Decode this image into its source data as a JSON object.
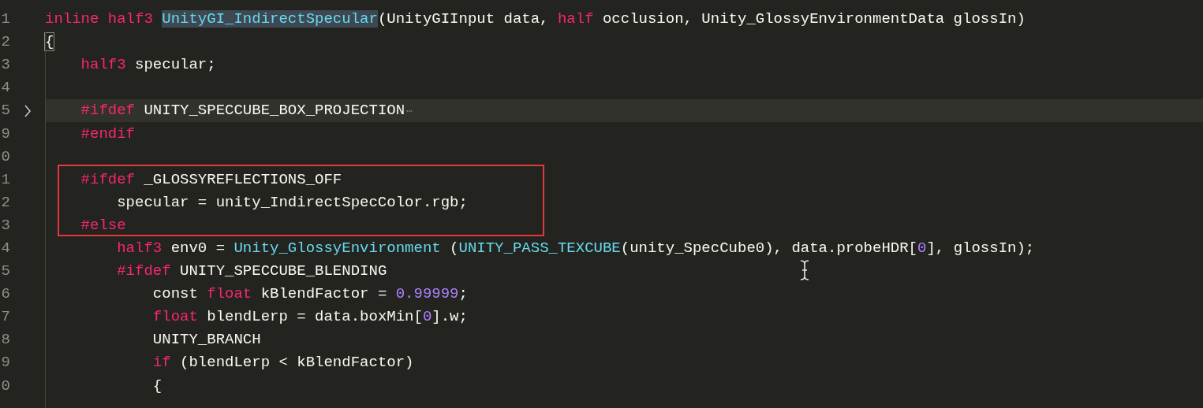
{
  "editor": {
    "lines": [
      {
        "number": "1",
        "tokens": [
          {
            "text": "inline half3 ",
            "kind": "keyword"
          },
          {
            "text": "UnityGI_IndirectSpecular",
            "kind": "selected"
          },
          {
            "text": "(UnityGIInput data, ",
            "kind": "plain"
          },
          {
            "text": "half",
            "kind": "keyword"
          },
          {
            "text": " occlusion, Unity_GlossyEnvironmentData glossIn)",
            "kind": "plain"
          }
        ]
      },
      {
        "number": "2",
        "tokens": [
          {
            "text": "{",
            "kind": "bracket-match"
          }
        ]
      },
      {
        "number": "3",
        "tokens": [
          {
            "text": "    half3",
            "kind": "keyword"
          },
          {
            "text": " specular;",
            "kind": "plain"
          }
        ]
      },
      {
        "number": "4"
      },
      {
        "number": "5",
        "folded": true,
        "current": true,
        "tokens": [
          {
            "text": "    #ifdef",
            "kind": "keyword"
          },
          {
            "text": " UNITY_SPECCUBE_BOX_PROJECTION",
            "kind": "plain"
          },
          {
            "text": "⋯",
            "kind": "fold-ellipsis"
          }
        ]
      },
      {
        "number": "9",
        "tokens": [
          {
            "text": "    #endif",
            "kind": "keyword"
          }
        ]
      },
      {
        "number": "0"
      },
      {
        "number": "1",
        "boxed": true,
        "tokens": [
          {
            "text": "    #ifdef",
            "kind": "keyword"
          },
          {
            "text": " _GLOSSYREFLECTIONS_OFF",
            "kind": "plain"
          }
        ]
      },
      {
        "number": "2",
        "boxed": true,
        "tokens": [
          {
            "text": "        specular = unity_IndirectSpecColor.rgb;",
            "kind": "plain"
          }
        ]
      },
      {
        "number": "3",
        "boxed": true,
        "tokens": [
          {
            "text": "    #else",
            "kind": "keyword"
          }
        ]
      },
      {
        "number": "4",
        "tokens": [
          {
            "text": "        half3",
            "kind": "keyword"
          },
          {
            "text": " env0 = ",
            "kind": "plain"
          },
          {
            "text": "Unity_GlossyEnvironment",
            "kind": "function"
          },
          {
            "text": " (",
            "kind": "plain"
          },
          {
            "text": "UNITY_PASS_TEXCUBE",
            "kind": "function"
          },
          {
            "text": "(unity_SpecCube0), data.probeHDR[",
            "kind": "plain"
          },
          {
            "text": "0",
            "kind": "number"
          },
          {
            "text": "], glossIn);",
            "kind": "plain"
          }
        ]
      },
      {
        "number": "5",
        "tokens": [
          {
            "text": "        #ifdef",
            "kind": "keyword"
          },
          {
            "text": " UNITY_SPECCUBE_BLENDING",
            "kind": "plain"
          }
        ]
      },
      {
        "number": "6",
        "tokens": [
          {
            "text": "            const ",
            "kind": "plain"
          },
          {
            "text": "float",
            "kind": "keyword"
          },
          {
            "text": " kBlendFactor = ",
            "kind": "plain"
          },
          {
            "text": "0.99999",
            "kind": "number"
          },
          {
            "text": ";",
            "kind": "plain"
          }
        ]
      },
      {
        "number": "7",
        "tokens": [
          {
            "text": "            float",
            "kind": "keyword"
          },
          {
            "text": " blendLerp = data.boxMin[",
            "kind": "plain"
          },
          {
            "text": "0",
            "kind": "number"
          },
          {
            "text": "].w;",
            "kind": "plain"
          }
        ]
      },
      {
        "number": "8",
        "tokens": [
          {
            "text": "            UNITY_BRANCH",
            "kind": "plain"
          }
        ]
      },
      {
        "number": "9",
        "tokens": [
          {
            "text": "            if",
            "kind": "keyword"
          },
          {
            "text": " (blendLerp < kBlendFactor)",
            "kind": "plain"
          }
        ]
      },
      {
        "number": "0",
        "tokens": [
          {
            "text": "            {",
            "kind": "plain"
          }
        ]
      }
    ]
  }
}
